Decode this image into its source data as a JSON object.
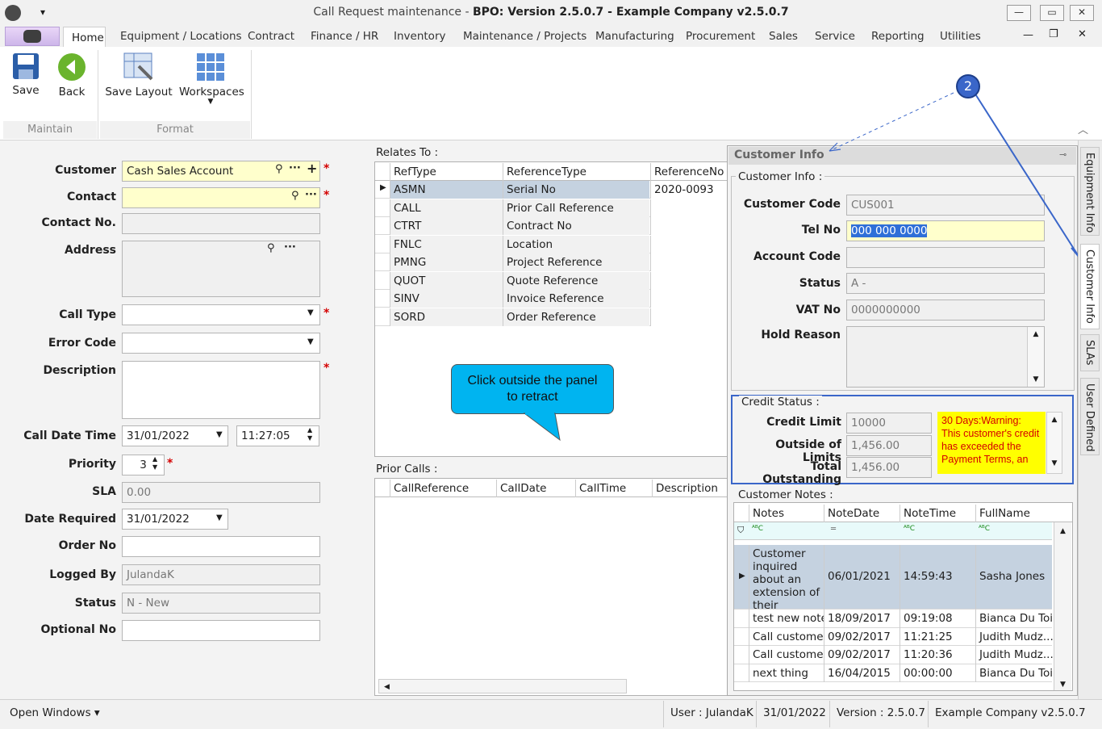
{
  "window": {
    "title_plain": "Call Request maintenance - ",
    "title_bold": "BPO: Version 2.5.0.7 - Example Company v2.5.0.7",
    "min": "—",
    "max": "▭",
    "close": "✕"
  },
  "menu": {
    "home": "Home",
    "tabs": [
      "Equipment / Locations",
      "Contract",
      "Finance / HR",
      "Inventory",
      "Maintenance / Projects",
      "Manufacturing",
      "Procurement",
      "Sales",
      "Service",
      "Reporting",
      "Utilities"
    ]
  },
  "ribbon": {
    "save": "Save",
    "back": "Back",
    "save_layout": "Save Layout",
    "workspaces": "Workspaces",
    "group_maintain": "Maintain",
    "group_format": "Format"
  },
  "form": {
    "customer_label": "Customer",
    "customer_value": "Cash Sales Account",
    "contact_label": "Contact",
    "contact_no_label": "Contact No.",
    "address_label": "Address",
    "call_type_label": "Call Type",
    "error_code_label": "Error Code",
    "description_label": "Description",
    "call_date_label": "Call Date Time",
    "call_date": "31/01/2022",
    "call_time": "11:27:05",
    "priority_label": "Priority",
    "priority": "3",
    "sla_label": "SLA",
    "sla": "0.00",
    "date_required_label": "Date Required",
    "date_required": "31/01/2022",
    "order_no_label": "Order No",
    "logged_by_label": "Logged By",
    "logged_by": "JulandaK",
    "status_label": "Status",
    "status": "N - New",
    "optional_no_label": "Optional No"
  },
  "relates": {
    "caption": "Relates To :",
    "headers": [
      "RefType",
      "ReferenceType",
      "ReferenceNo"
    ],
    "rows": [
      [
        "ASMN",
        "Serial No",
        "2020-0093"
      ],
      [
        "CALL",
        "Prior Call Reference",
        ""
      ],
      [
        "CTRT",
        "Contract No",
        ""
      ],
      [
        "FNLC",
        "Location",
        ""
      ],
      [
        "PMNG",
        "Project Reference",
        ""
      ],
      [
        "QUOT",
        "Quote Reference",
        ""
      ],
      [
        "SINV",
        "Invoice Reference",
        ""
      ],
      [
        "SORD",
        "Order Reference",
        ""
      ]
    ]
  },
  "callout": {
    "text_line1": "Click outside the panel",
    "text_line2": "to retract"
  },
  "prior": {
    "caption": "Prior Calls :",
    "headers": [
      "CallReference",
      "CallDate",
      "CallTime",
      "Description"
    ]
  },
  "panel": {
    "title": "Customer Info",
    "pin": "⊸",
    "section": "Customer Info :",
    "customer_code_label": "Customer Code",
    "customer_code": "CUS001",
    "tel_label": "Tel No",
    "tel": "000 000 0000",
    "account_code_label": "Account Code",
    "status_label": "Status",
    "status": "A -",
    "vat_label": "VAT No",
    "vat": "0000000000",
    "hold_label": "Hold Reason",
    "credit_caption": "Credit Status :",
    "credit_limit_label": "Credit Limit",
    "credit_limit": "10000",
    "outside_label": "Outside of Limits",
    "outside": "1,456.00",
    "total_label": "Total Outstanding",
    "total": "1,456.00",
    "warning": "30 Days:Warning: This customer's credit has exceeded the Payment Terms, an",
    "notes_caption": "Customer Notes :",
    "notes_headers": [
      "Notes",
      "NoteDate",
      "NoteTime",
      "FullName"
    ],
    "filter_abc": "ᴬᴮC",
    "filter_eq": "═",
    "notes_rows": [
      [
        "Customer inquired about an extension of their",
        "06/01/2021",
        "14:59:43",
        "Sasha Jones"
      ],
      [
        "test new note",
        "18/09/2017",
        "09:19:08",
        "Bianca Du Toit"
      ],
      [
        "Call customer",
        "09/02/2017",
        "11:21:25",
        "Judith Mudz..."
      ],
      [
        "Call customer",
        "09/02/2017",
        "11:20:36",
        "Judith Mudz..."
      ],
      [
        "next thing",
        "16/04/2015",
        "00:00:00",
        "Bianca Du Toit"
      ]
    ],
    "marker": "2"
  },
  "sidetabs": [
    "Equipment Info",
    "Customer Info",
    "SLAs",
    "User Defined"
  ],
  "statusbar": {
    "open_windows": "Open Windows ▾",
    "user": "User : JulandaK",
    "date": "31/01/2022",
    "version": "Version : 2.5.0.7",
    "company": "Example Company v2.5.0.7"
  },
  "colors": {
    "accent": "#3a66c9",
    "callout": "#00b4f0",
    "warning_bg": "#ffff00",
    "warning_text": "#d40000",
    "selected_row": "#c5d2e0"
  }
}
